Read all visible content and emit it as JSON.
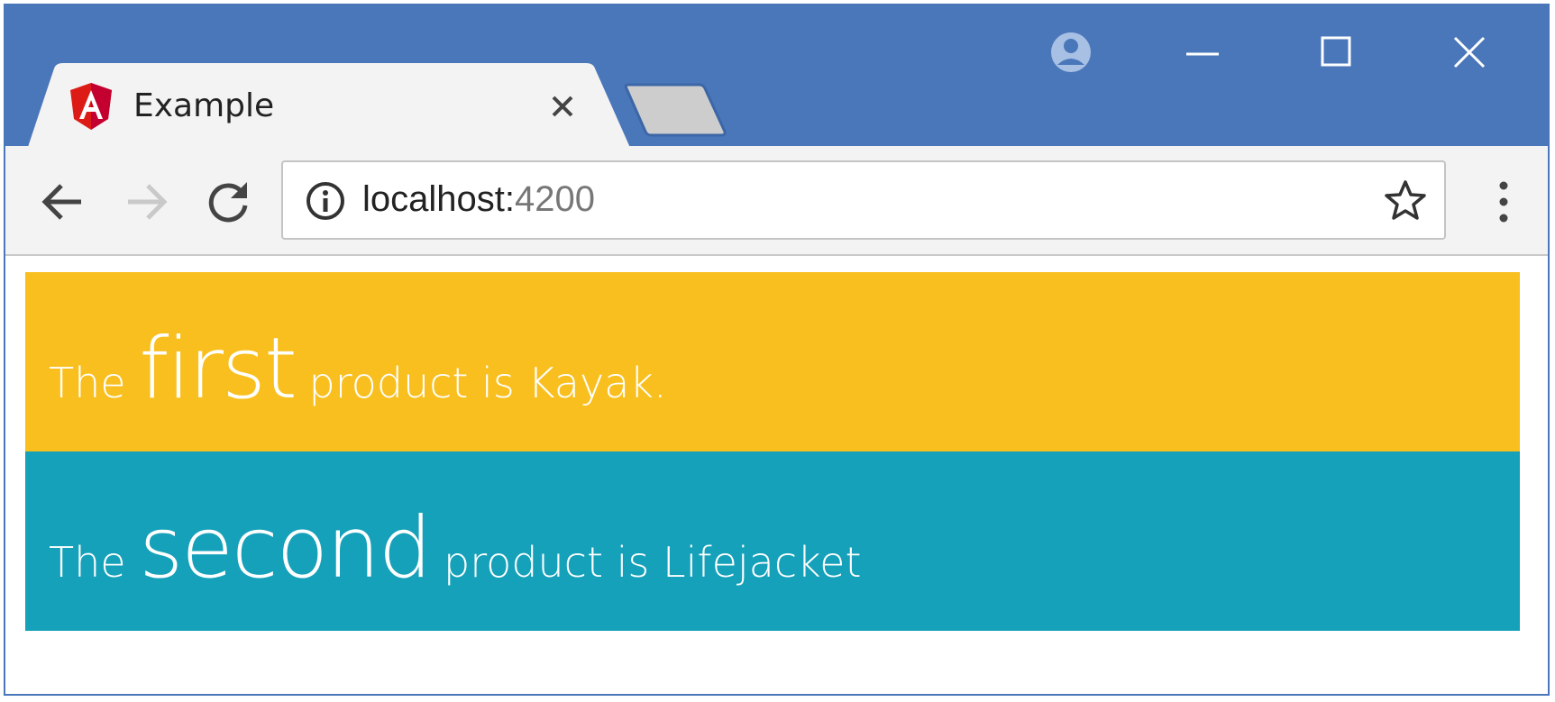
{
  "tab": {
    "title": "Example",
    "favicon_icon": "angular-logo-icon",
    "close_icon": "close-icon"
  },
  "window_controls": {
    "profile_icon": "profile-icon",
    "minimize_icon": "minimize-icon",
    "maximize_icon": "maximize-icon",
    "close_icon": "close-icon"
  },
  "toolbar": {
    "back_icon": "back-arrow-icon",
    "forward_icon": "forward-arrow-icon",
    "reload_icon": "reload-icon",
    "url_host": "localhost:",
    "url_port": "4200",
    "info_icon": "info-icon",
    "bookmark_icon": "star-icon",
    "menu_icon": "kebab-menu-icon"
  },
  "content": {
    "first": {
      "pre": "The ",
      "big": "first",
      "post": " product is Kayak.",
      "bg": "#f8bf1e"
    },
    "second": {
      "pre": "The ",
      "big": "second",
      "post": " product is Lifejacket",
      "bg": "#15a1b9"
    }
  },
  "colors": {
    "titlebar": "#4a77ba",
    "toolbar": "#f3f3f3",
    "text": "#ffffff"
  }
}
